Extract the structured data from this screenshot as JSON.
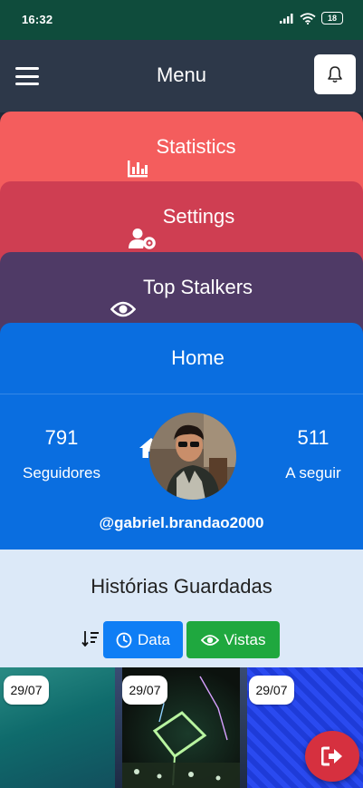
{
  "status_bar": {
    "time": "16:32",
    "battery": "18"
  },
  "header": {
    "title": "Menu"
  },
  "menu": {
    "statistics": "Statistics",
    "settings": "Settings",
    "top_stalkers": "Top Stalkers",
    "home": "Home"
  },
  "profile": {
    "followers_count": "791",
    "followers_label": "Seguidores",
    "following_count": "511",
    "following_label": "A seguir",
    "username": "@gabriel.brandao2000"
  },
  "saved_stories": {
    "title": "Histórias Guardadas",
    "sort_by_date_label": "Data",
    "sort_by_views_label": "Vistas",
    "stories": [
      {
        "date": "29/07"
      },
      {
        "date": "29/07"
      },
      {
        "date": "29/07"
      }
    ]
  },
  "colors": {
    "statistics": "#f45d5d",
    "settings": "#cf3e52",
    "top_stalkers": "#4f3a66",
    "home": "#0a6ee0",
    "data_button": "#0f7ef5",
    "views_button": "#1fa83f",
    "logout": "#d6303f"
  },
  "icons": {
    "menu": "hamburger-icon",
    "notifications": "bell-icon",
    "statistics": "bar-chart-icon",
    "settings": "user-cog-icon",
    "top_stalkers": "eye-icon",
    "home": "home-icon",
    "sort": "sort-icon",
    "date": "clock-icon",
    "views": "eye-icon",
    "logout": "sign-out-icon"
  }
}
